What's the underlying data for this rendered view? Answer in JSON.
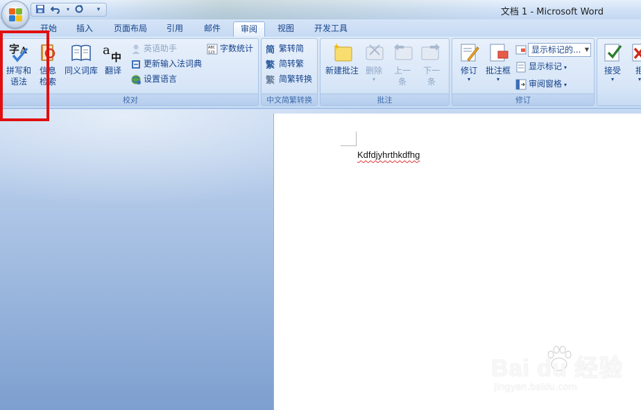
{
  "window": {
    "title": "文档 1 - Microsoft Word"
  },
  "quick_access": {
    "items": [
      "save-icon",
      "undo-icon",
      "redo-icon",
      "customize-icon"
    ]
  },
  "tabs": [
    {
      "label": "开始",
      "active": false
    },
    {
      "label": "插入",
      "active": false
    },
    {
      "label": "页面布局",
      "active": false
    },
    {
      "label": "引用",
      "active": false
    },
    {
      "label": "邮件",
      "active": false
    },
    {
      "label": "审阅",
      "active": true
    },
    {
      "label": "视图",
      "active": false
    },
    {
      "label": "开发工具",
      "active": false
    }
  ],
  "ribbon": {
    "proofing": {
      "label": "校对",
      "spelling_line1": "拼写和",
      "spelling_line2": "语法",
      "research_line1": "信息",
      "research_line2": "检索",
      "thesaurus": "同义词库",
      "translate": "翻译",
      "english_assistant": "英语助手",
      "update_ime": "更新输入法词典",
      "set_language": "设置语言",
      "word_count": "字数统计"
    },
    "chinese_conversion": {
      "label": "中文简繁转换",
      "to_simplified": "繁转简",
      "to_traditional": "简转繁",
      "convert": "简繁转换"
    },
    "comments": {
      "label": "批注",
      "new_comment": "新建批注",
      "delete": "删除",
      "previous_line1": "上一",
      "previous_line2": "条",
      "next_line1": "下一",
      "next_line2": "条"
    },
    "tracking": {
      "label": "修订",
      "track_changes": "修订",
      "balloons": "批注框",
      "display_for_review": "显示标记的...",
      "show_markup": "显示标记",
      "reviewing_pane": "审阅窗格"
    },
    "changes": {
      "accept": "接受",
      "reject_partial": "拒"
    }
  },
  "document": {
    "text": "Kdfdjyhrthkdfhg"
  },
  "watermark": {
    "brand": "Bai du 经验",
    "url": "jingyan.baidu.com"
  },
  "colors": {
    "highlight": "#e01010",
    "ribbon_text": "#15428b"
  }
}
